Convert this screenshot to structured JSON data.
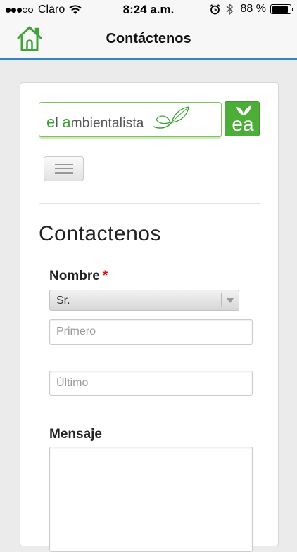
{
  "status_bar": {
    "carrier": "Claro",
    "time": "8:24 a.m.",
    "battery_percent": "88 %",
    "battery_level": 0.88,
    "signal_bars_filled": 3,
    "signal_bars_total": 5
  },
  "nav": {
    "title": "Contáctenos",
    "home_icon": "home-icon"
  },
  "logo": {
    "prefix": "e",
    "el_rest": "l ",
    "a_letter": "a",
    "rest": "mbientalista",
    "badge": "ea"
  },
  "form": {
    "page_title": "Contactenos",
    "name_label": "Nombre",
    "required_mark": "*",
    "salutation_value": "Sr.",
    "first_placeholder": "Primero",
    "last_placeholder": "Último",
    "message_label": "Mensaje"
  },
  "colors": {
    "accent_blue": "#2f86c6",
    "brand_green": "#4cad38",
    "required_red": "#dd1111"
  }
}
